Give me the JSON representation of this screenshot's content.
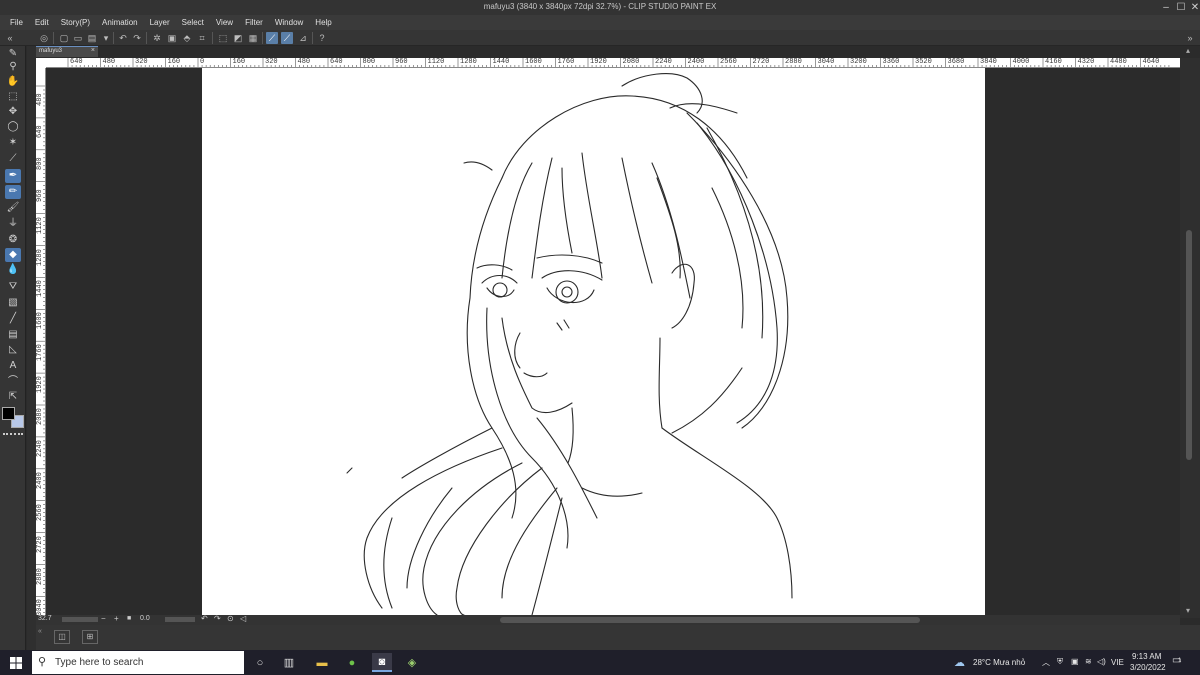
{
  "window": {
    "title": "mafuyu3 (3840 x 3840px 72dpi 32.7%)  - CLIP STUDIO PAINT EX",
    "minimize": "–",
    "maximize": "☐",
    "close": "✕"
  },
  "menu": [
    "File",
    "Edit",
    "Story(P)",
    "Animation",
    "Layer",
    "Select",
    "View",
    "Filter",
    "Window",
    "Help"
  ],
  "document_tab": {
    "label": "mafuyu3",
    "close": "×"
  },
  "ruler_top": [
    "640",
    "480",
    "320",
    "160",
    "0",
    "160",
    "320",
    "480",
    "640",
    "800",
    "960",
    "1120",
    "1280",
    "1440",
    "1600",
    "1760",
    "1920",
    "2080",
    "2240",
    "2400",
    "2560",
    "2720",
    "2880",
    "3040",
    "3200",
    "3360",
    "3520",
    "3680",
    "3840",
    "4000",
    "4160",
    "4320",
    "4480",
    "4640"
  ],
  "ruler_left": [
    "480",
    "640",
    "800",
    "960",
    "1120",
    "1280",
    "1440",
    "1600",
    "1760",
    "1920",
    "2080",
    "2240",
    "2400",
    "2560",
    "2720",
    "2880",
    "3040"
  ],
  "status": {
    "zoom": "32.7",
    "rotation": "0.0"
  },
  "taskbar": {
    "search_placeholder": "Type here to search",
    "weather": "28°C  Mưa nhỏ",
    "language": "VIE",
    "time": "9:13 AM",
    "date": "3/20/2022",
    "notification_count": "1"
  },
  "colors": {
    "accent": "#4a78b0",
    "main_color": "#000000",
    "sub_color": "#b8c8e8"
  }
}
